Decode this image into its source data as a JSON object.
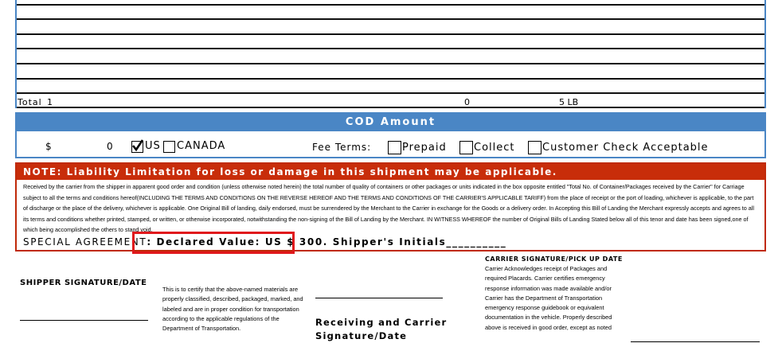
{
  "totals": {
    "label": "Total",
    "count": "1",
    "cod_units": "0",
    "weight": "5 LB"
  },
  "cod": {
    "header": "COD Amount",
    "currency_symbol": "$",
    "amount": "0",
    "us_label": "US",
    "us_checked": true,
    "canada_label": "CANADA",
    "fee_terms_label": "Fee Terms:",
    "prepaid_label": "Prepaid",
    "collect_label": "Collect",
    "customer_check_label": "Customer Check Acceptable",
    "accent_color": "#4a86c5"
  },
  "notice": {
    "header": "NOTE: Liability Limitation for loss or damage in this shipment may be applicable.",
    "body": "Received by the carrier from the shipper in apparent good order and condition (unless otherwise noted herein) the total number of quality of containers or other packages or units indicated in the box opposite entitled \"Total No. of Container/Packages received by the Carrier\" for Carriage subject to all the terms and conditions hereof(INCLUDING THE TERMS AND CONDITIONS ON THE REVERSE HEREOF AND THE TERMS AND CONDITIONS OF THE CARRIER'S APPLICABLE TARIFF) from the place of receipt or the port of loading, whichever is applicable, to the part of discharge or the place of the delivery, whichever is applicable. One Original Bill of landing, daily endorsed, must be surrendered by the Merchant to the Carrier in exchange for the Goods or a delivery order. In Accepting this Bill of Landing the Merchant expressly accepts and agrees to all its terms and conditions whether printed, stamped, or written, or otherwise incorporated, notwithstanding the non-signing of the Bill of Landing by the Merchant. IN WITNESS WHEREOF the number of Original Bills of Landing Stated below all of this tenor and date has been signed,one of which being accomplished the others to stand void.",
    "special_agreement_label": "SPECIAL AGREEMENT",
    "declared_value_text": ": Declared Value: US $ 300.",
    "shipper_initials_text": " Shipper's Initials__________",
    "accent_color": "#c82d0a"
  },
  "bottom": {
    "shipper_signature_label": "SHIPPER SIGNATURE/DATE",
    "certify_text": "This is to certify that the above-named materials are properly classified, described, packaged, marked, and labeled and are in proper condition for transportation according to the applicable regulations of the Department of Transportation.",
    "receiving_label_1": "Receiving and Carrier",
    "receiving_label_2": "Signature/Date",
    "carrier_signature_label": "CARRIER SIGNATURE/PICK UP DATE",
    "carrier_text": "Carrier Acknowledges receipt of Packages and required Placards. Carrier certifies emergency response information was made available and/or Carrier has the Department of Transportation emergency response guidebook or equivalent documentation in the vehicle. Properly described above is received in good order, except as noted"
  },
  "highlight_color": "#e0181c"
}
